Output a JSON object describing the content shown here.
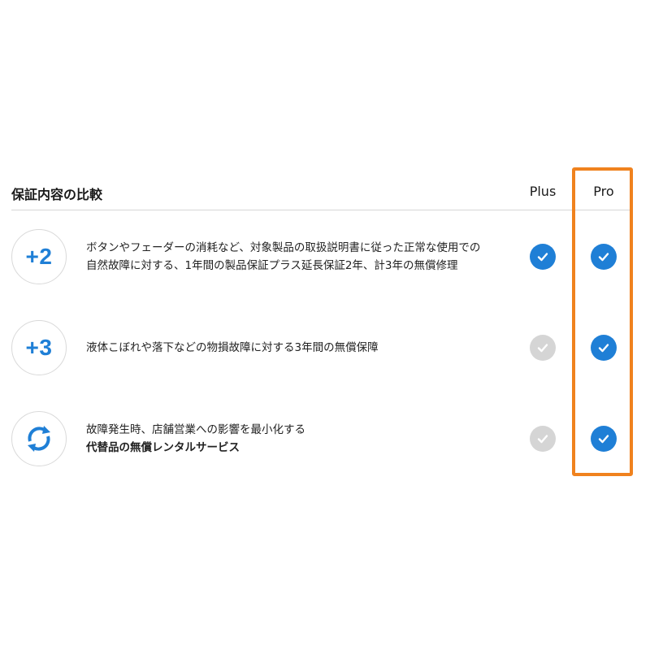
{
  "section": {
    "title": "保証内容の比較",
    "columns": {
      "plus": "Plus",
      "pro": "Pro"
    }
  },
  "rows": [
    {
      "badge": "+2",
      "icon": null,
      "lines": [
        "ボタンやフェーダーの消耗など、対象製品の取扱説明書に従った正常な使用での",
        "自然故障に対する、1年間の製品保証プラス延長保証2年、計3年の無償修理"
      ],
      "plus": true,
      "pro": true
    },
    {
      "badge": "+3",
      "icon": null,
      "lines": [
        "液体こぼれや落下などの物損故障に対する3年間の無償保障"
      ],
      "plus": false,
      "pro": true
    },
    {
      "badge": "",
      "icon": "sync-arrows-icon",
      "lines": [
        "故障発生時、店舗営業への影響を最小化する",
        "代替品の無償レンタルサービス"
      ],
      "plus": false,
      "pro": true
    }
  ],
  "colors": {
    "accent": "#1f7fd6",
    "inactive_check": "#d5d5d5",
    "highlight_border": "#f0821e",
    "divider": "#d6d6d6"
  }
}
